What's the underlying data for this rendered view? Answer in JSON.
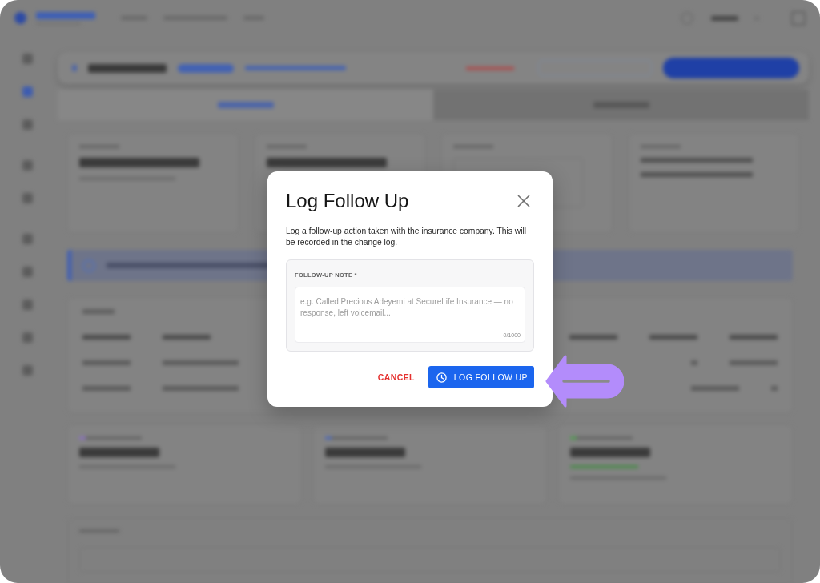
{
  "dialog": {
    "title": "Log Follow Up",
    "description": "Log a follow-up action taken with the insurance company. This will be recorded in the change log.",
    "note_field": {
      "label": "FOLLOW-UP NOTE *",
      "placeholder": "e.g. Called Precious Adeyemi at SecureLife Insurance — no response, left voicemail...",
      "counter": "0/1000"
    },
    "buttons": [
      {
        "label": "CANCEL",
        "kind": "text"
      },
      {
        "label": "LOG FOLLOW UP",
        "kind": "primary"
      }
    ]
  }
}
